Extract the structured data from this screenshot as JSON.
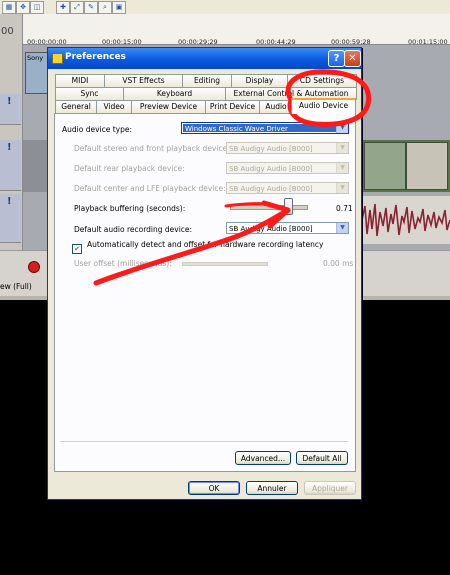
{
  "window": {
    "title": "Preferences"
  },
  "tabs_row1": [
    {
      "label": "MIDI"
    },
    {
      "label": "VST Effects"
    },
    {
      "label": "Editing"
    },
    {
      "label": "Display"
    },
    {
      "label": "CD Settings"
    }
  ],
  "tabs_row2": [
    {
      "label": "Sync"
    },
    {
      "label": "Keyboard"
    },
    {
      "label": "External Control & Automation"
    }
  ],
  "tabs_row3": [
    {
      "label": "General"
    },
    {
      "label": "Video"
    },
    {
      "label": "Preview Device"
    },
    {
      "label": "Print Device"
    },
    {
      "label": "Audio"
    },
    {
      "label": "Audio Device"
    }
  ],
  "audio_device": {
    "device_type_label": "Audio device type:",
    "device_type_value": "Windows Classic Wave Driver",
    "front_label": "Default stereo and front playback device:",
    "front_value": "SB Audigy Audio [B000]",
    "rear_label": "Default rear playback device:",
    "rear_value": "SB Audigy Audio [B000]",
    "center_label": "Default center and LFE playback device:",
    "center_value": "SB Audigy Audio [B000]",
    "buffering_label": "Playback buffering (seconds):",
    "buffering_value": "0.71",
    "buffering_fraction": 0.71,
    "recording_label": "Default audio recording device:",
    "recording_value": "SB Audigy Audio [B000]",
    "auto_detect_label": "Automatically detect and offset for hardware recording latency",
    "auto_detect_checked": true,
    "user_offset_label": "User offset (milliseconds):",
    "user_offset_value": "0.00 ms"
  },
  "buttons": {
    "advanced": "Advanced...",
    "default_all": "Default All",
    "ok": "OK",
    "cancel": "Annuler",
    "apply": "Appliquer"
  },
  "background_app": {
    "left_number": "00",
    "timecodes": [
      "00:00:00;00",
      "00:00:15;00",
      "00:00:29;29",
      "00:00:44;29",
      "00:00:59;28",
      "00:01:15;00"
    ],
    "clip_label": "Sony",
    "view_label": "ew (Full)"
  },
  "colors": {
    "titlebar": "#0a5adf",
    "selection": "#316ac5",
    "annotation": "#ff1a1a",
    "record": "#d41f1f"
  }
}
